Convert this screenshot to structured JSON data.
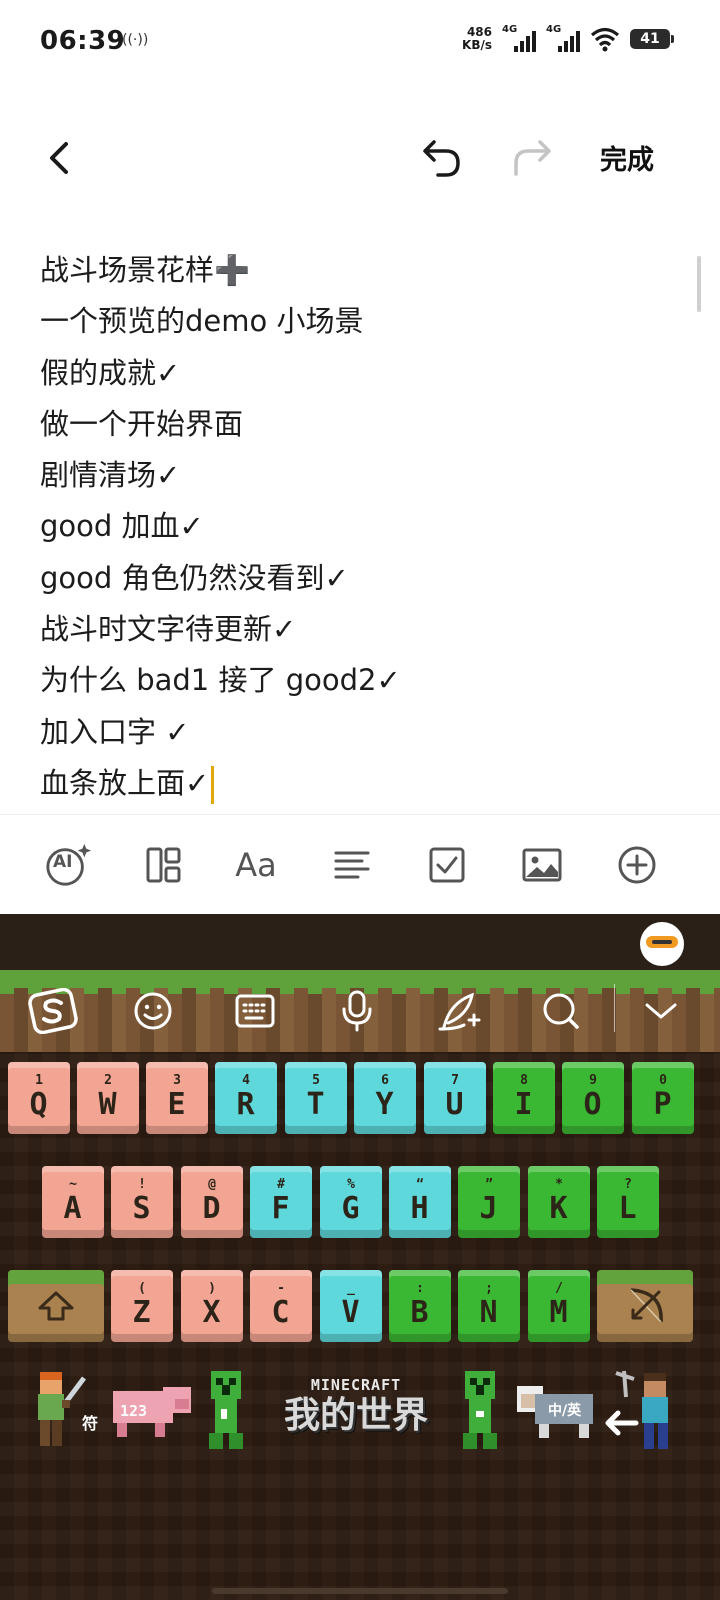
{
  "status_bar": {
    "time": "06:39",
    "hotspot_label": "((·))",
    "net_speed_value": "486",
    "net_speed_unit": "KB/s",
    "sim1_label": "4G",
    "sim2_label": "4G",
    "battery_level": "41"
  },
  "topnav": {
    "done_label": "完成"
  },
  "note": {
    "lines": [
      "战斗场景花样➕",
      "一个预览的demo 小场景",
      "假的成就✓",
      "做一个开始界面",
      "剧情清场✓",
      "good 加血✓",
      "good 角色仍然没看到✓",
      "战斗时文字待更新✓",
      "为什么 bad1 接了 good2✓",
      "加入口字 ✓",
      "血条放上面✓"
    ]
  },
  "editor_toolbar": {
    "ai_label": "AI",
    "font_label": "Aa"
  },
  "keyboard": {
    "colors": {
      "pink": "#f3a594",
      "cyan": "#5fd8dc",
      "green": "#3bb833",
      "dirt": "#a9824f"
    },
    "row1": [
      {
        "hint": "1",
        "letter": "Q"
      },
      {
        "hint": "2",
        "letter": "W"
      },
      {
        "hint": "3",
        "letter": "E"
      },
      {
        "hint": "4",
        "letter": "R"
      },
      {
        "hint": "5",
        "letter": "T"
      },
      {
        "hint": "6",
        "letter": "Y"
      },
      {
        "hint": "7",
        "letter": "U"
      },
      {
        "hint": "8",
        "letter": "I"
      },
      {
        "hint": "9",
        "letter": "O"
      },
      {
        "hint": "0",
        "letter": "P"
      }
    ],
    "row2": [
      {
        "hint": "~",
        "letter": "A"
      },
      {
        "hint": "!",
        "letter": "S"
      },
      {
        "hint": "@",
        "letter": "D"
      },
      {
        "hint": "#",
        "letter": "F"
      },
      {
        "hint": "%",
        "letter": "G"
      },
      {
        "hint": "“",
        "letter": "H"
      },
      {
        "hint": "”",
        "letter": "J"
      },
      {
        "hint": "*",
        "letter": "K"
      },
      {
        "hint": "?",
        "letter": "L"
      }
    ],
    "row3": [
      {
        "hint": "(",
        "letter": "Z"
      },
      {
        "hint": ")",
        "letter": "X"
      },
      {
        "hint": "-",
        "letter": "C"
      },
      {
        "hint": "_",
        "letter": "V"
      },
      {
        "hint": ":",
        "letter": "B"
      },
      {
        "hint": ";",
        "letter": "N"
      },
      {
        "hint": "/",
        "letter": "M"
      }
    ],
    "bottom": {
      "symbols_label": "符",
      "numbers_label": "123",
      "logo_en": "MINECRAFT",
      "logo_cn": "我的世界",
      "lang_label": "中/英"
    }
  }
}
